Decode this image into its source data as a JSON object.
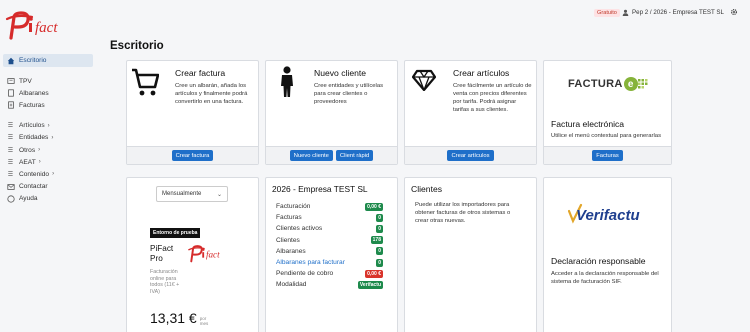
{
  "app": {
    "logo_text": "fact"
  },
  "topbar": {
    "plan_badge": "Gratuito",
    "user_info": "Pep 2 / 2026 - Empresa TEST SL"
  },
  "sidebar": {
    "items": [
      {
        "label": "Escritorio",
        "icon": "home-icon"
      },
      {
        "label": "TPV",
        "icon": "tpv-icon"
      },
      {
        "label": "Albaranes",
        "icon": "albaranes-icon"
      },
      {
        "label": "Facturas",
        "icon": "facturas-icon"
      },
      {
        "label": "Artículos",
        "icon": "list-icon"
      },
      {
        "label": "Entidades",
        "icon": "list-icon"
      },
      {
        "label": "Otros",
        "icon": "list-icon"
      },
      {
        "label": "AEAT",
        "icon": "list-icon"
      },
      {
        "label": "Contenido",
        "icon": "list-icon"
      },
      {
        "label": "Contactar",
        "icon": "mail-icon"
      },
      {
        "label": "Ayuda",
        "icon": "help-icon"
      }
    ]
  },
  "main": {
    "title": "Escritorio"
  },
  "cards": {
    "crear_factura": {
      "title": "Crear factura",
      "text": "Cree un albarán, añada los artículos y finalmente podrá convertirlo en una factura.",
      "button": "Crear factura"
    },
    "nuevo_cliente": {
      "title": "Nuevo cliente",
      "text": "Cree entidades y utilícelas para crear clientes o proveedores",
      "button1": "Nuevo cliente",
      "button2": "Client ràpid"
    },
    "crear_articulos": {
      "title": "Crear artículos",
      "text": "Cree fácilmente un artículo de venta con precios diferentes por tarifa. Podrá asignar tarifas a sus clientes.",
      "button": "Crear artículos"
    },
    "factura_electronica": {
      "logo_text": "FACTURA",
      "logo_e": "e",
      "title": "Factura electrónica",
      "text": "Utilice el menú contextual para generarlas",
      "button": "Facturas"
    },
    "plan": {
      "select": "Mensualmente",
      "env_badge": "Entorno de prueba",
      "name_line1": "PiFact",
      "name_line2": "Pro",
      "desc": "Facturación online para todos (11€ + IVA)",
      "price": "13,31 €",
      "price_unit": "por mes"
    },
    "empresa": {
      "title": "2026 - Empresa TEST SL",
      "rows": [
        {
          "label": "Facturación",
          "value": "0,00 €",
          "color": "green",
          "link": false
        },
        {
          "label": "Facturas",
          "value": "0",
          "color": "green",
          "link": false
        },
        {
          "label": "Clientes activos",
          "value": "0",
          "color": "green",
          "link": false
        },
        {
          "label": "Clientes",
          "value": "178",
          "color": "green",
          "link": false
        },
        {
          "label": "Albaranes",
          "value": "0",
          "color": "green",
          "link": false
        },
        {
          "label": "Albaranes para facturar",
          "value": "0",
          "color": "green",
          "link": true
        },
        {
          "label": "Pendiente de cobro",
          "value": "0,00 €",
          "color": "red",
          "link": false
        },
        {
          "label": "Modalidad",
          "value": "Verifactu",
          "color": "green",
          "link": false
        }
      ]
    },
    "clientes": {
      "title": "Clientes",
      "text": "Puede utilizar los importadores para obtener facturas de otros sistemas o crear otras nuevas."
    },
    "verifactu": {
      "logo_text": "Verifactu",
      "title": "Declaración responsable",
      "text": "Acceder a la declaración responsable del sistema de facturación SIF."
    }
  }
}
